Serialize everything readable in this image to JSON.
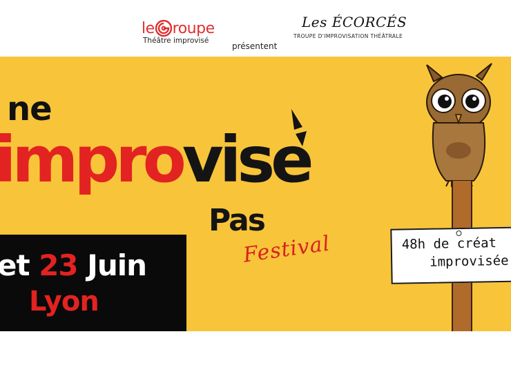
{
  "header": {
    "logo_left": {
      "word_before": "le",
      "word_after": "roupe",
      "subtitle": "Théâtre improvisé"
    },
    "presentent": "présentent",
    "logo_right": {
      "title": "Les ÉCORCÉS",
      "subtitle": "TROUPE D'IMPROVISATION THÉÂTRALE"
    }
  },
  "banner": {
    "line_ne": "ne",
    "improvise_part1": "impro",
    "improvise_part2": "vise",
    "line_pas": "Pas",
    "festival": "Festival",
    "date": {
      "part1": "et ",
      "day": "23",
      "part2": " Juin"
    },
    "city": "Lyon",
    "sign": {
      "line1": "48h de créat",
      "line2": "improvisée"
    }
  },
  "colors": {
    "banner_bg": "#f8c43a",
    "accent_red": "#e22321",
    "text_black": "#141414",
    "pole_brown": "#b06a2a"
  },
  "icons": {
    "logo_spiral": "spiral-g-icon",
    "owl": "owl-illustration-icon",
    "accent": "accent-mark-icon"
  }
}
